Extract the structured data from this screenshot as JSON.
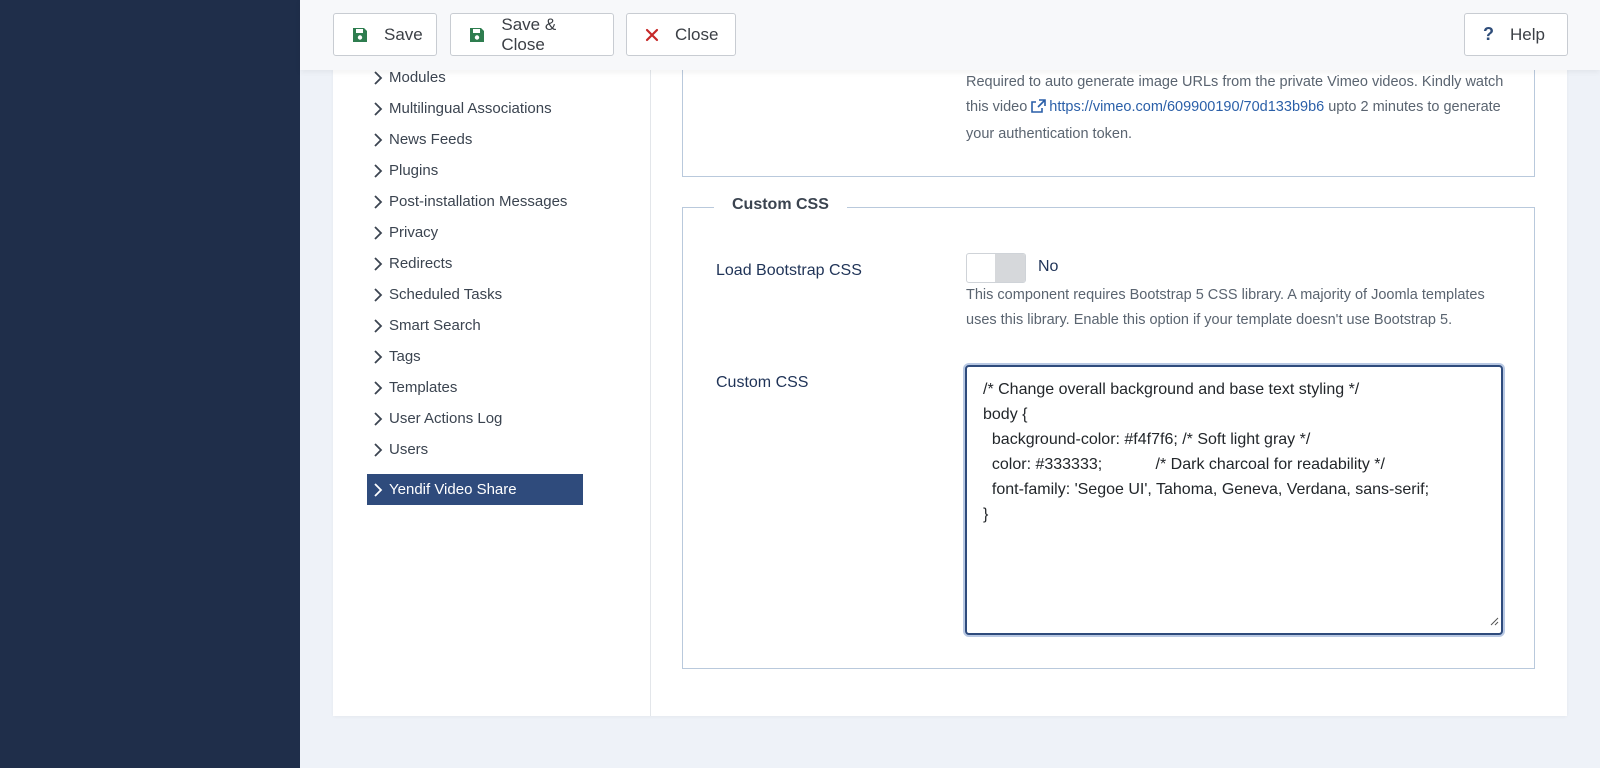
{
  "toolbar": {
    "save_label": "Save",
    "save_close_label": "Save & Close",
    "close_label": "Close",
    "help_label": "Help"
  },
  "sidebar": {
    "items": [
      {
        "label": "Modules",
        "active": false
      },
      {
        "label": "Multilingual Associations",
        "active": false
      },
      {
        "label": "News Feeds",
        "active": false
      },
      {
        "label": "Plugins",
        "active": false
      },
      {
        "label": "Post-installation Messages",
        "active": false
      },
      {
        "label": "Privacy",
        "active": false
      },
      {
        "label": "Redirects",
        "active": false
      },
      {
        "label": "Scheduled Tasks",
        "active": false
      },
      {
        "label": "Smart Search",
        "active": false
      },
      {
        "label": "Tags",
        "active": false
      },
      {
        "label": "Templates",
        "active": false
      },
      {
        "label": "User Actions Log",
        "active": false
      },
      {
        "label": "Users",
        "active": false
      },
      {
        "label": "Yendif Video Share",
        "active": true
      }
    ]
  },
  "vimeo": {
    "desc_before": "Required to auto generate image URLs from the private Vimeo videos. Kindly watch this video ",
    "link_text": "https://vimeo.com/609900190/70d133b9b6",
    "desc_after": " upto 2 minutes to generate your authentication token."
  },
  "custom_css_section": {
    "legend": "Custom CSS",
    "load_bootstrap_label": "Load Bootstrap CSS",
    "load_bootstrap_value": "No",
    "load_bootstrap_desc": "This component requires Bootstrap 5 CSS library. A majority of Joomla templates uses this library. Enable this option if your template doesn't use Bootstrap 5.",
    "custom_css_label": "Custom CSS",
    "custom_css_lines": [
      "/* Change overall background and base text styling */",
      "body {",
      "  background-color: #f4f7f6; /* Soft light gray */",
      "  color: #333333;            /* Dark charcoal for readability */",
      "  font-family: 'Segoe UI', Tahoma, Geneva, Verdana, sans-serif;",
      "}"
    ]
  },
  "colors": {
    "sidebar_bg": "#1f2e4a",
    "active_item_bg": "#2f4b7c",
    "save_icon": "#2e7d4f",
    "close_icon": "#c62828",
    "link": "#2a5fa8"
  }
}
